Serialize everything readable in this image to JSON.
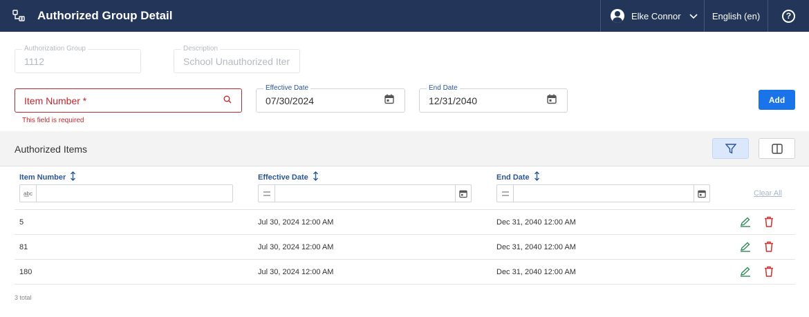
{
  "header": {
    "title": "Authorized Group Detail",
    "user_name": "Elke Connor",
    "language": "English (en)",
    "help_glyph": "?",
    "colors": {
      "topbar": "#233659"
    }
  },
  "form": {
    "auth_group": {
      "label": "Authorization Group",
      "value": "1112"
    },
    "description": {
      "label": "Description",
      "value": "School Unauthorized Iter"
    },
    "item_number": {
      "placeholder": "Item Number *",
      "error": "This field is required"
    },
    "effective_date": {
      "label": "Effective Date",
      "value": "07/30/2024"
    },
    "end_date": {
      "label": "End Date",
      "value": "12/31/2040"
    },
    "add_label": "Add"
  },
  "section": {
    "title": "Authorized Items"
  },
  "table": {
    "columns": [
      {
        "label": "Item Number",
        "filter_prefix": "a͟bc"
      },
      {
        "label": "Effective Date"
      },
      {
        "label": "End Date"
      }
    ],
    "clear_all": "Clear All",
    "rows": [
      {
        "item_number": "5",
        "effective": "Jul 30, 2024 12:00 AM",
        "end": "Dec 31, 2040 12:00 AM"
      },
      {
        "item_number": "81",
        "effective": "Jul 30, 2024 12:00 AM",
        "end": "Dec 31, 2040 12:00 AM"
      },
      {
        "item_number": "180",
        "effective": "Jul 30, 2024 12:00 AM",
        "end": "Dec 31, 2040 12:00 AM"
      }
    ],
    "total": "3 total"
  }
}
